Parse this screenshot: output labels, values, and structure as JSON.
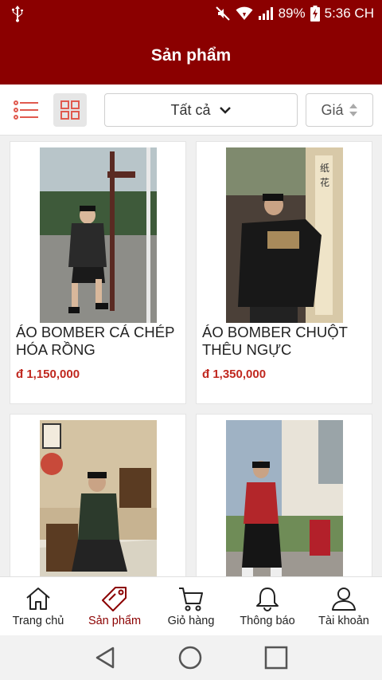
{
  "status_bar": {
    "battery": "89%",
    "time": "5:36 CH"
  },
  "header": {
    "title": "Sản phẩm"
  },
  "filters": {
    "category_selected": "Tất cả",
    "sort_label": "Giá"
  },
  "products": [
    {
      "name": "ÁO BOMBER CÁ CHÉP HÓA RỒNG",
      "price": "đ 1,150,000"
    },
    {
      "name": "ÁO BOMBER CHUỘT THÊU NGỰC",
      "price": "đ 1,350,000"
    },
    {
      "name": "",
      "price": ""
    },
    {
      "name": "",
      "price": ""
    }
  ],
  "bottom_nav": {
    "items": [
      {
        "label": "Trang chủ",
        "icon": "home-icon"
      },
      {
        "label": "Sản phẩm",
        "icon": "tag-icon",
        "active": true
      },
      {
        "label": "Giỏ hàng",
        "icon": "cart-icon"
      },
      {
        "label": "Thông báo",
        "icon": "bell-icon"
      },
      {
        "label": "Tài khoản",
        "icon": "user-icon"
      }
    ]
  },
  "colors": {
    "brand": "#8b0000",
    "price": "#c0281f"
  }
}
